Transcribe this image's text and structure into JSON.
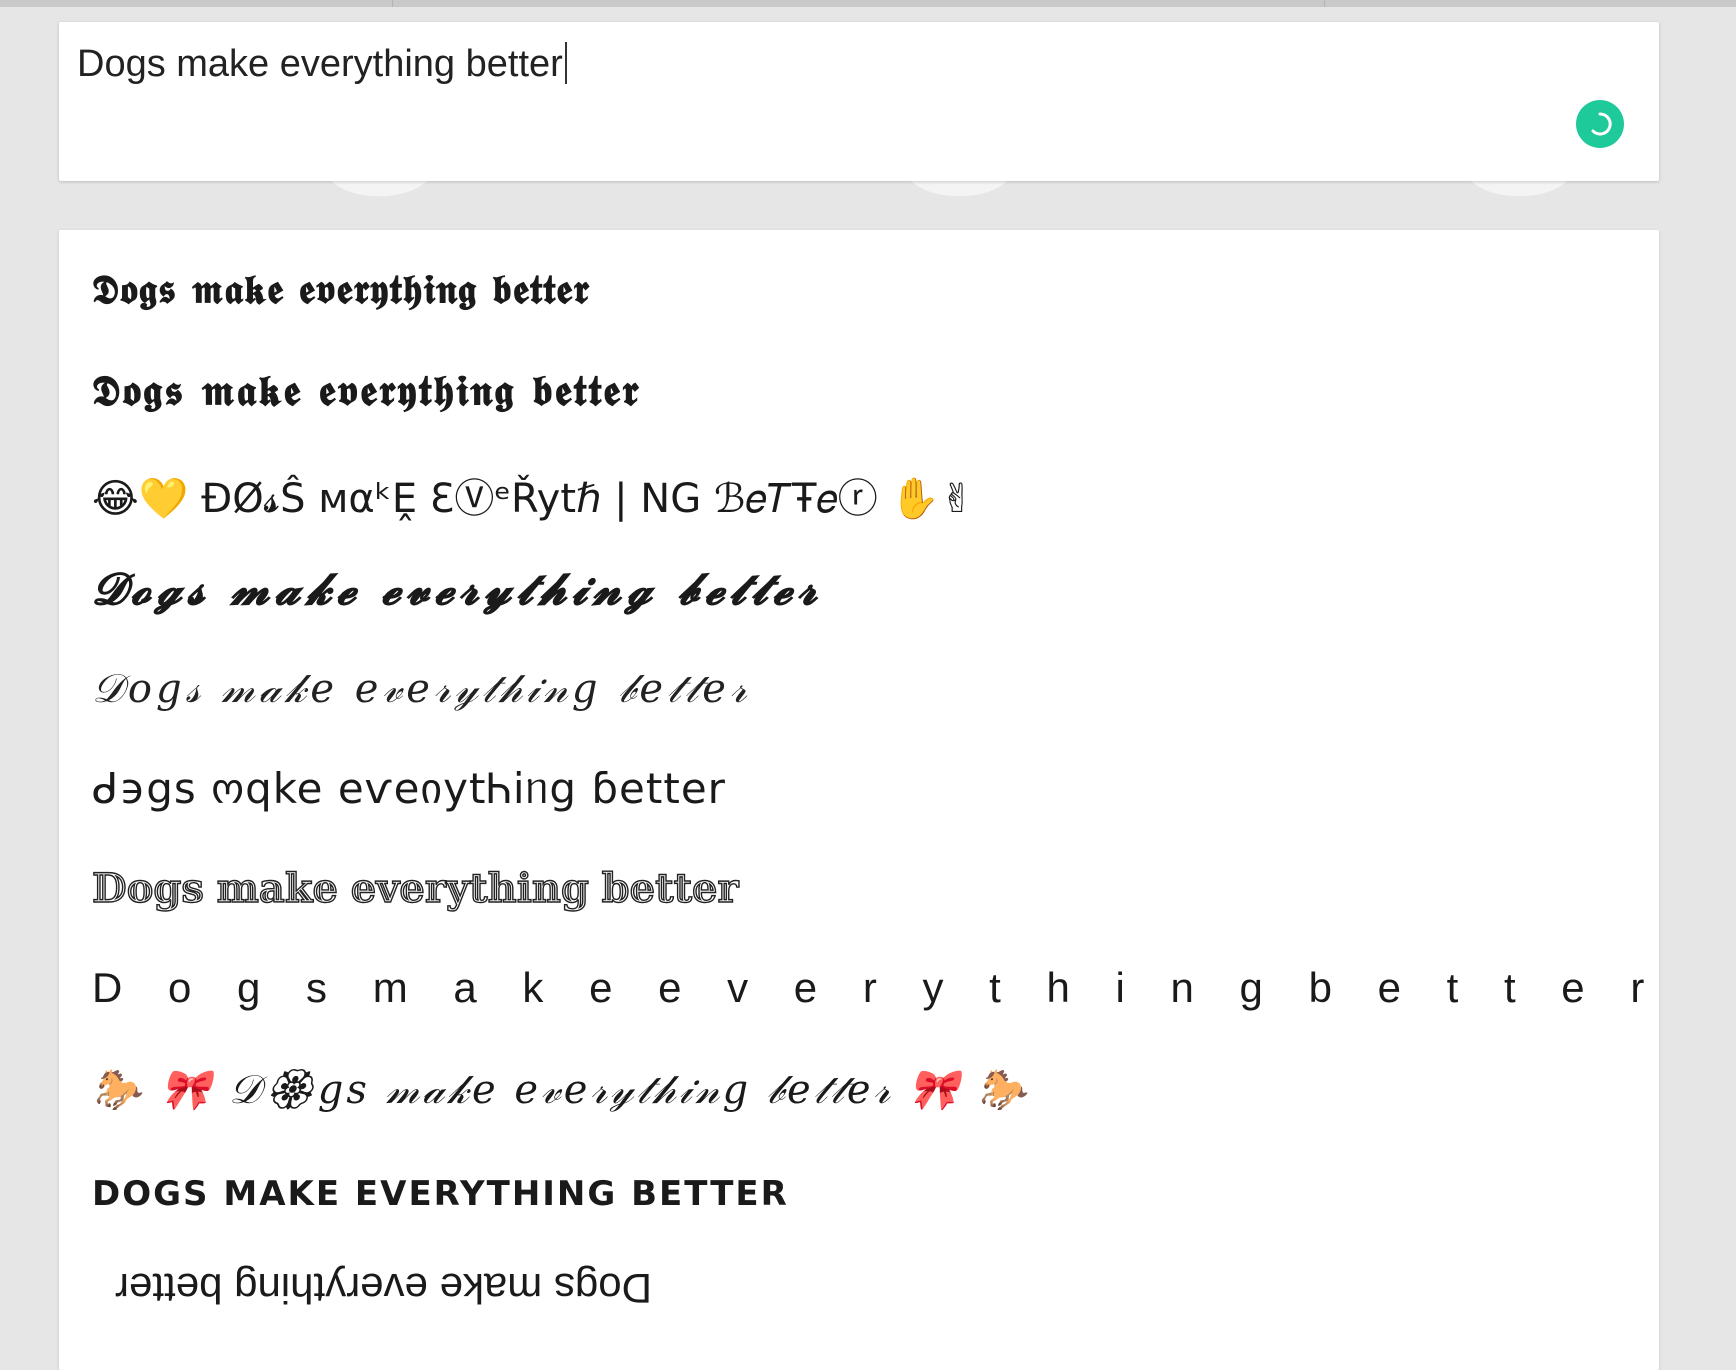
{
  "input": {
    "value": "Dogs make everything better"
  },
  "icons": {
    "submit": "loading-spinner-icon",
    "accent_color": "#1ec99a"
  },
  "results": [
    {
      "text": "𝕯𝖔𝖌𝖘 𝖒𝖆𝖐𝖊 𝖊𝖛𝖊𝖗𝖞𝖙𝖍𝖎𝖓𝖌 𝖇𝖊𝖙𝖙𝖊𝖗"
    },
    {
      "text": "𝕯𝖔𝖌𝖘 𝖒𝖆𝖐𝖊 𝖊𝖛𝖊𝖗𝖞𝖙𝖍𝖎𝖓𝖌 𝖇𝖊𝖙𝖙𝖊𝖗"
    },
    {
      "text": "😂💛  ĐØ𝓼Ŝ мαᵏḘ ƐⓋᵉŘytℏ | NG ℬ𝑒𝑇Ŧ𝑒ⓡ  ✋✌"
    },
    {
      "text": "𝓓𝓸𝓰𝓼 𝓶𝓪𝓴𝓮 𝓮𝓿𝓮𝓻𝔂𝓽𝓱𝓲𝓷𝓰 𝓫𝓮𝓽𝓽𝓮𝓻"
    },
    {
      "text": "𝒟𝑜𝑔𝓈 𝓂𝒶𝓀𝑒 𝑒𝓋𝑒𝓇𝓎𝓉𝒽𝒾𝓃𝑔 𝒷𝑒𝓉𝓉𝑒𝓇"
    },
    {
      "text": "ᑯ϶gs ოqke eѵeიytᏂiᥒg ɓetter"
    },
    {
      "text": "𝔻𝕠𝕘𝕤 𝕞𝕒𝕜𝕖 𝕖𝕧𝕖𝕣𝕪𝕥𝕙𝕚𝕟𝕘 𝕓𝕖𝕥𝕥𝕖𝕣"
    },
    {
      "text": "D o g s m a k e e v e r y t h i n g b e t t e r"
    },
    {
      "text": "🐎 🎀 𝒟🏵gs 𝓂𝒶𝓀𝑒 𝑒𝓋𝑒𝓇𝓎𝓉𝒽𝒾𝓃𝑔 𝒷𝑒𝓉𝓉𝑒𝓇 🎀 🐎"
    },
    {
      "text": "DOGS MAKE EVERYTHING BETTER"
    },
    {
      "text": "Dogs make everything better"
    }
  ]
}
